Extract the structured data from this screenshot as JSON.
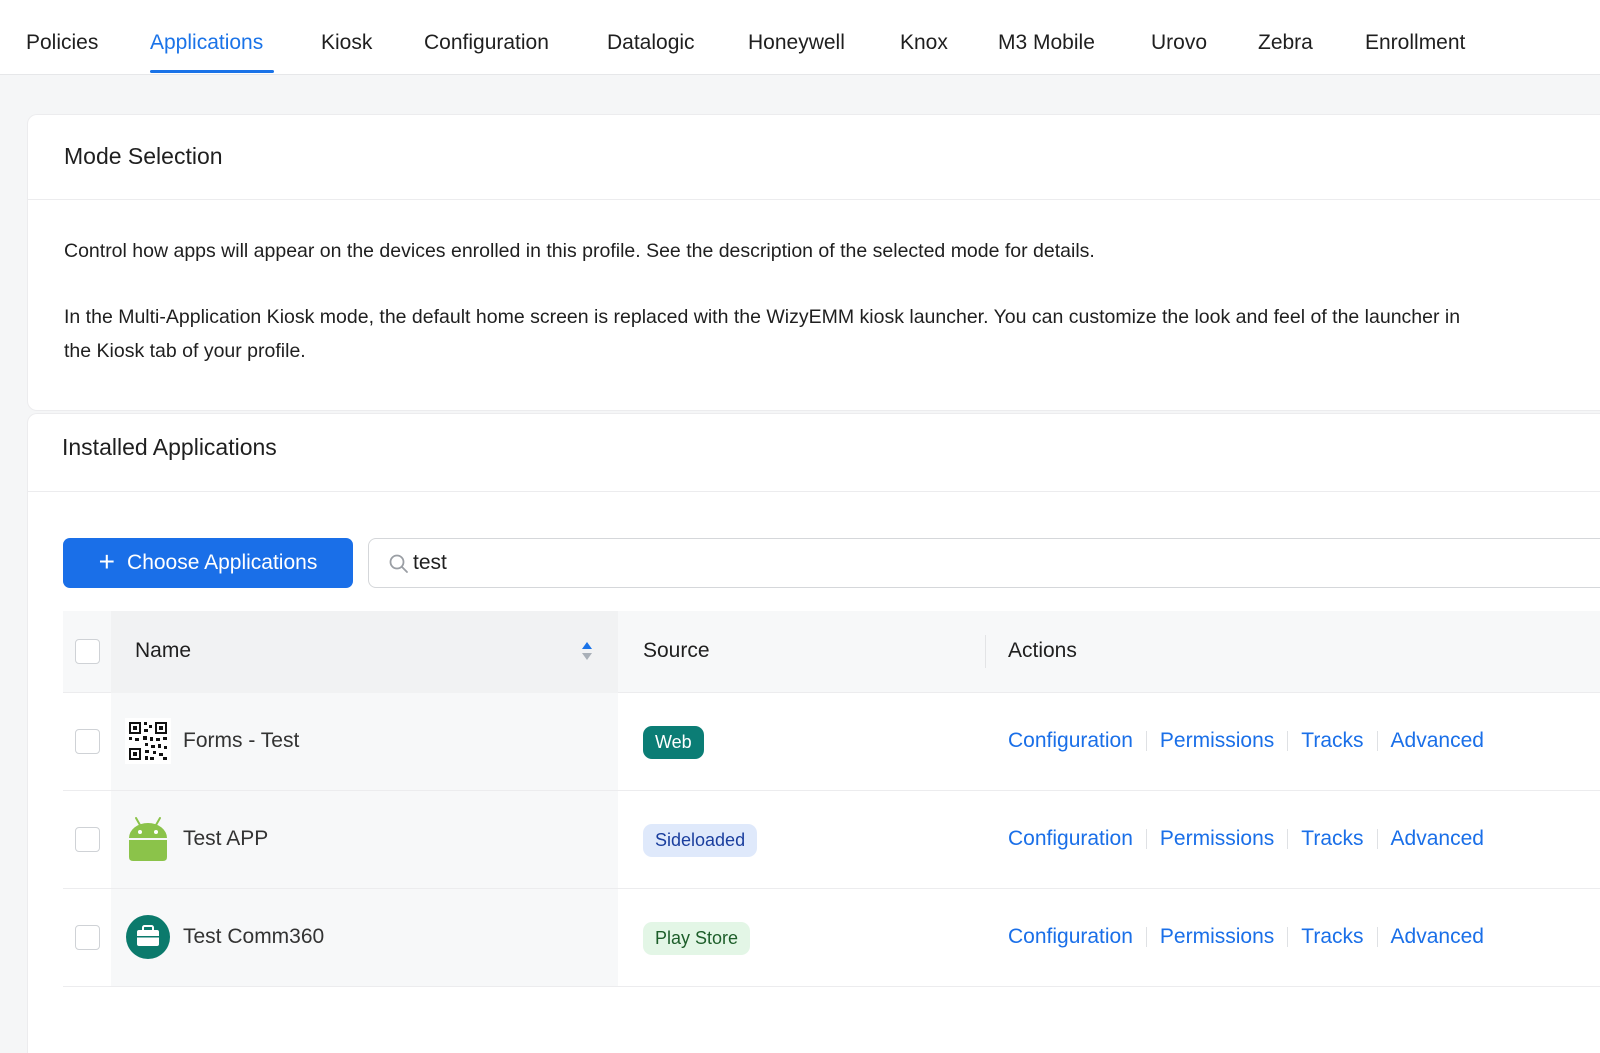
{
  "tabs": [
    {
      "label": "Policies"
    },
    {
      "label": "Applications",
      "active": true
    },
    {
      "label": "Kiosk"
    },
    {
      "label": "Configuration"
    },
    {
      "label": "Datalogic"
    },
    {
      "label": "Honeywell"
    },
    {
      "label": "Knox"
    },
    {
      "label": "M3 Mobile"
    },
    {
      "label": "Urovo"
    },
    {
      "label": "Zebra"
    },
    {
      "label": "Enrollment"
    }
  ],
  "mode_selection": {
    "title": "Mode Selection",
    "paragraph1": "Control how apps will appear on the devices enrolled in this profile. See the description of the selected mode for details.",
    "paragraph2": "In the Multi-Application Kiosk mode, the default home screen is replaced with the WizyEMM kiosk launcher. You can customize the look and feel of the launcher in the Kiosk tab of your profile."
  },
  "installed": {
    "title": "Installed Applications",
    "choose_button": "Choose Applications",
    "search_value": "test",
    "columns": {
      "name": "Name",
      "source": "Source",
      "actions": "Actions"
    },
    "action_labels": [
      "Configuration",
      "Permissions",
      "Tracks",
      "Advanced"
    ],
    "rows": [
      {
        "name": "Forms - Test",
        "source": "Web",
        "icon": "qr-code-icon"
      },
      {
        "name": "Test APP",
        "source": "Sideloaded",
        "icon": "android-icon"
      },
      {
        "name": "Test Comm360",
        "source": "Play Store",
        "icon": "briefcase-icon"
      }
    ]
  },
  "colors": {
    "accent": "#1a73e8",
    "web_badge": "#0b7d75",
    "sideloaded_badge": "#dfe9fb",
    "playstore_badge": "#e3f6e6"
  }
}
